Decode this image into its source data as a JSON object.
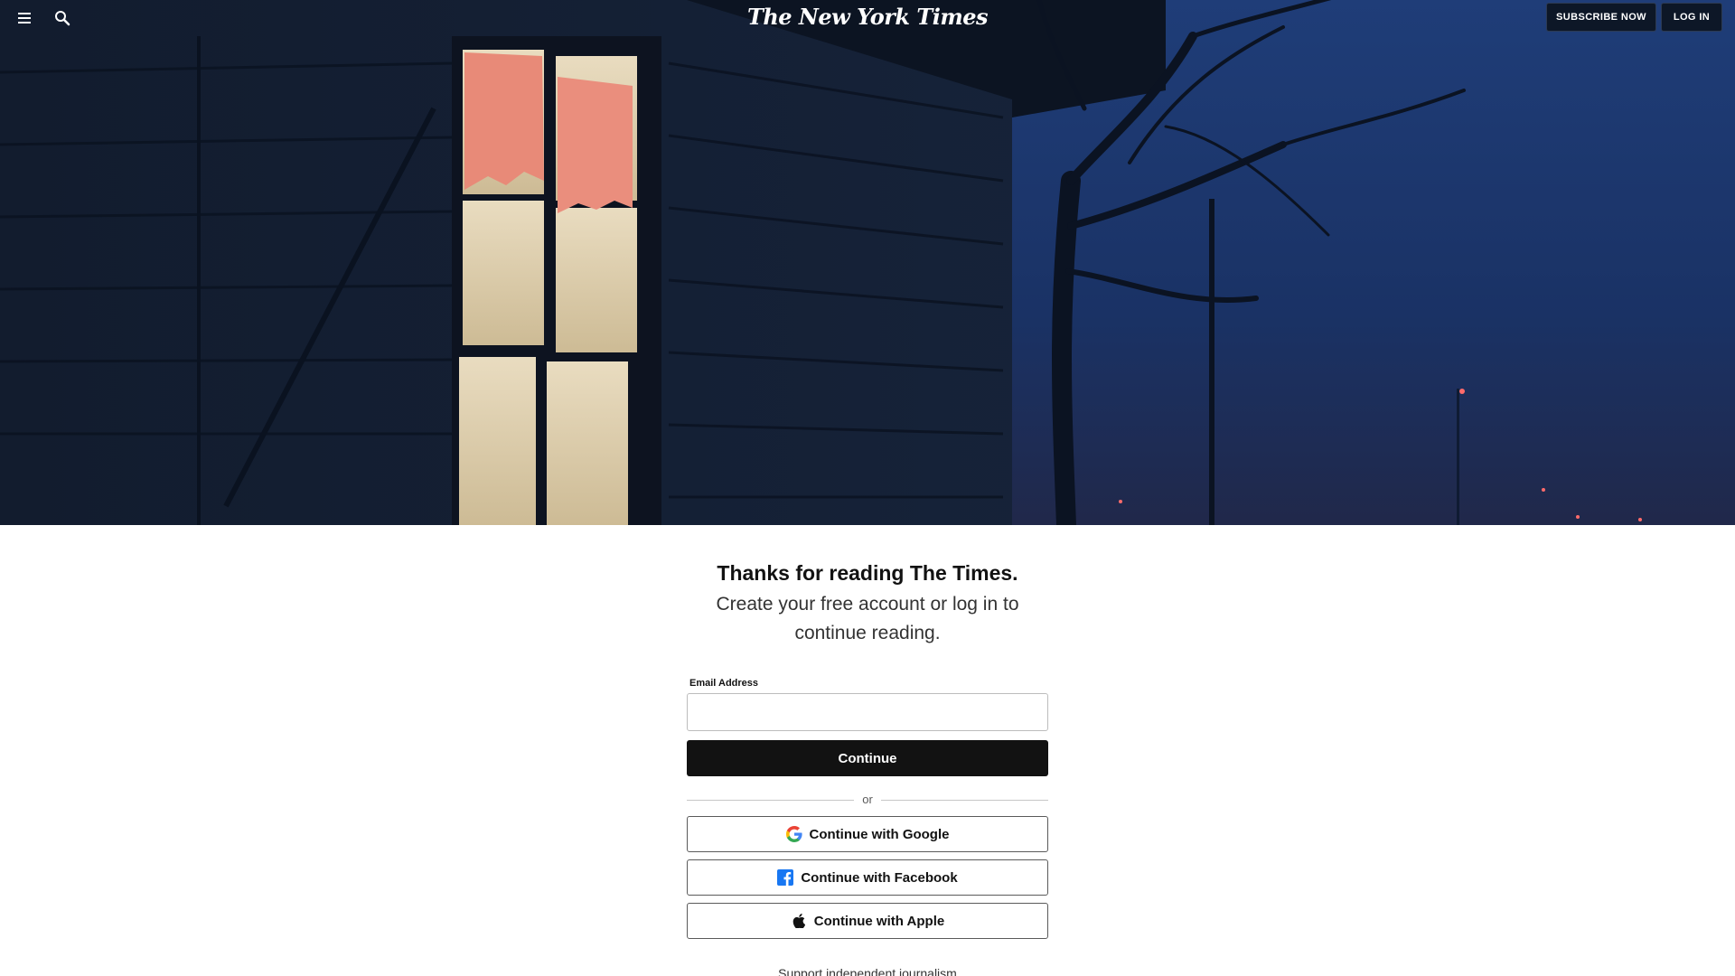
{
  "header": {
    "logo_text": "The New York Times",
    "subscribe_label": "SUBSCRIBE NOW",
    "login_label": "LOG IN",
    "menu_icon": "hamburger-menu-icon",
    "search_icon": "magnifier-search-icon"
  },
  "main": {
    "heading": "Thanks for reading The Times.",
    "subheading": "Create your free account or log in to continue reading.",
    "email_label": "Email Address",
    "email_value": "",
    "continue_label": "Continue",
    "divider_text": "or",
    "google_label": "Continue with Google",
    "facebook_label": "Continue with Facebook",
    "apple_label": "Continue with Apple",
    "footer_text": "Support independent journalism"
  },
  "colors": {
    "primary_button": "#121212",
    "header_button_bg": "#0d1727",
    "facebook_blue": "#1877f2"
  }
}
